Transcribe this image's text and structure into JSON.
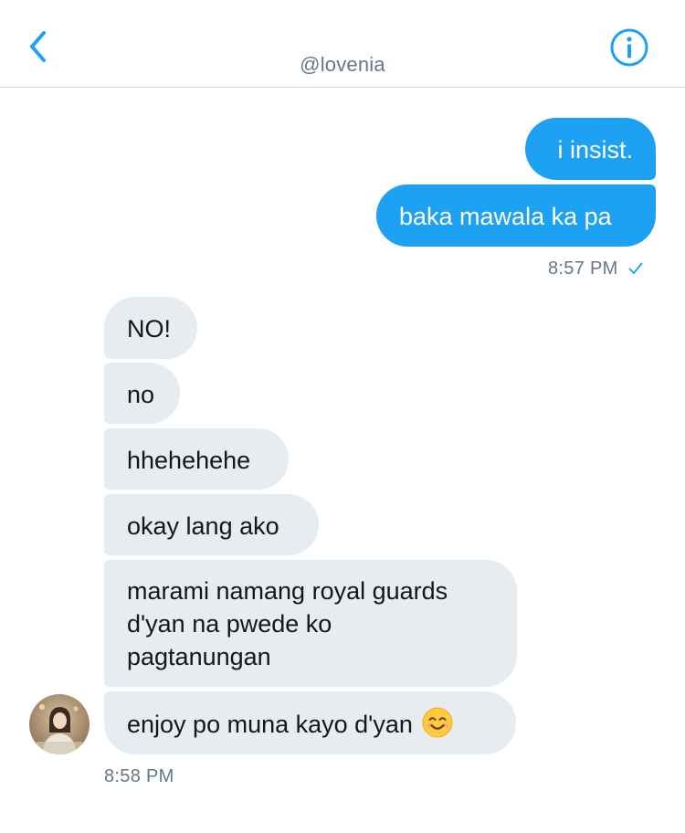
{
  "header": {
    "title": "@lovenia",
    "back_icon": "chevron-left-icon",
    "info_icon": "info-circle-icon",
    "accent_color": "#1da1f2"
  },
  "conversation": {
    "outgoing": [
      {
        "text": "i insist."
      },
      {
        "text": "baka mawala ka pa"
      }
    ],
    "outgoing_time": "8:57 PM",
    "outgoing_status_icon": "checkmark-icon",
    "incoming": [
      {
        "text": "NO!"
      },
      {
        "text": "no"
      },
      {
        "text": "hhehehehe"
      },
      {
        "text": "okay lang ako"
      },
      {
        "lines": [
          "marami namang royal guards",
          "d'yan na pwede ko",
          "pagtanungan"
        ]
      },
      {
        "text": "enjoy po muna kayo d'yan",
        "emoji": "smiling-face-emoji"
      }
    ],
    "incoming_time": "8:58 PM",
    "outgoing_bubble_color": "#1da1f2",
    "incoming_bubble_color": "#e6ecf0"
  }
}
